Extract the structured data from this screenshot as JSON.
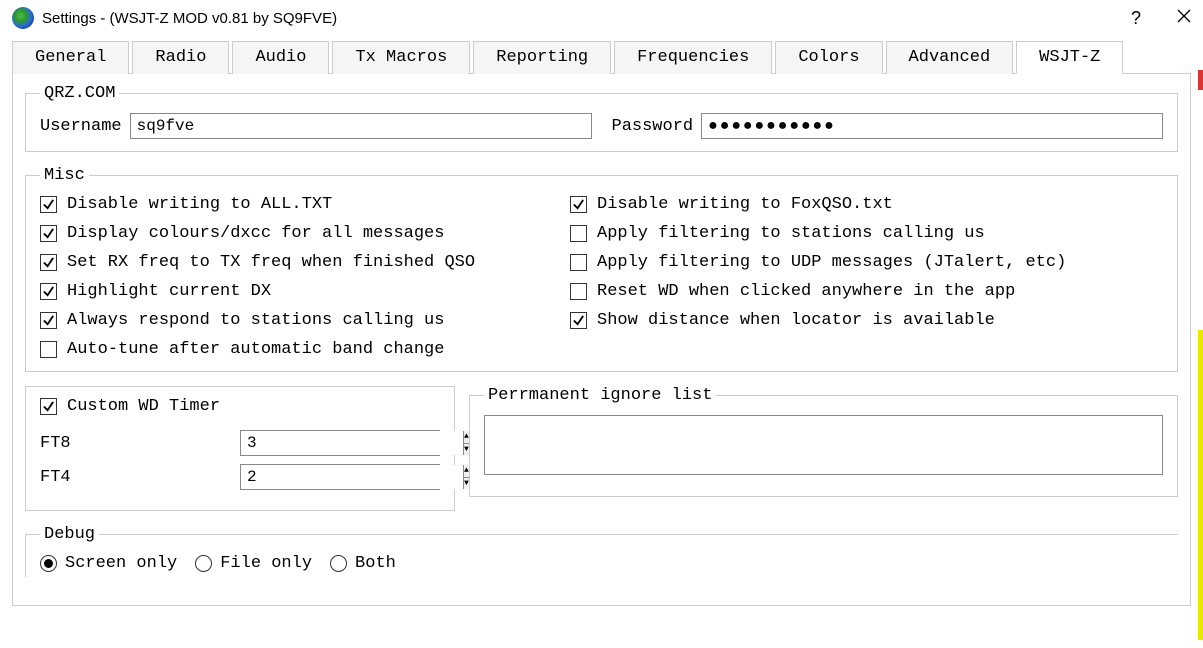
{
  "window": {
    "title": "Settings - (WSJT-Z MOD v0.81 by SQ9FVE)"
  },
  "tabs": [
    "General",
    "Radio",
    "Audio",
    "Tx Macros",
    "Reporting",
    "Frequencies",
    "Colors",
    "Advanced",
    "WSJT-Z"
  ],
  "active_tab": "WSJT-Z",
  "qrz": {
    "legend": "QRZ.COM",
    "username_label": "Username",
    "username": "sq9fve",
    "password_label": "Password",
    "password": "●●●●●●●●●●●"
  },
  "misc": {
    "legend": "Misc",
    "items": [
      {
        "label": "Disable writing to ALL.TXT",
        "checked": true
      },
      {
        "label": "Disable writing to FoxQSO.txt",
        "checked": true
      },
      {
        "label": "Display colours/dxcc for all messages",
        "checked": true
      },
      {
        "label": "Apply filtering to stations calling us",
        "checked": false
      },
      {
        "label": "Set RX freq to TX freq when finished QSO",
        "checked": true
      },
      {
        "label": "Apply filtering to UDP messages (JTalert, etc)",
        "checked": false
      },
      {
        "label": "Highlight current DX",
        "checked": true
      },
      {
        "label": "Reset WD when clicked anywhere in the app",
        "checked": false
      },
      {
        "label": "Always respond to stations calling us",
        "checked": true
      },
      {
        "label": "Show distance when locator is available",
        "checked": true
      },
      {
        "label": "Auto-tune after automatic band change",
        "checked": false
      }
    ]
  },
  "timer": {
    "header_label": "Custom WD Timer",
    "header_checked": true,
    "ft8_label": "FT8",
    "ft8_value": "3",
    "ft4_label": "FT4",
    "ft4_value": "2"
  },
  "ignore": {
    "legend": "Perrmanent ignore list",
    "value": ""
  },
  "debug": {
    "legend": "Debug",
    "options": [
      {
        "label": "Screen only",
        "checked": true
      },
      {
        "label": "File only",
        "checked": false
      },
      {
        "label": "Both",
        "checked": false
      }
    ]
  }
}
